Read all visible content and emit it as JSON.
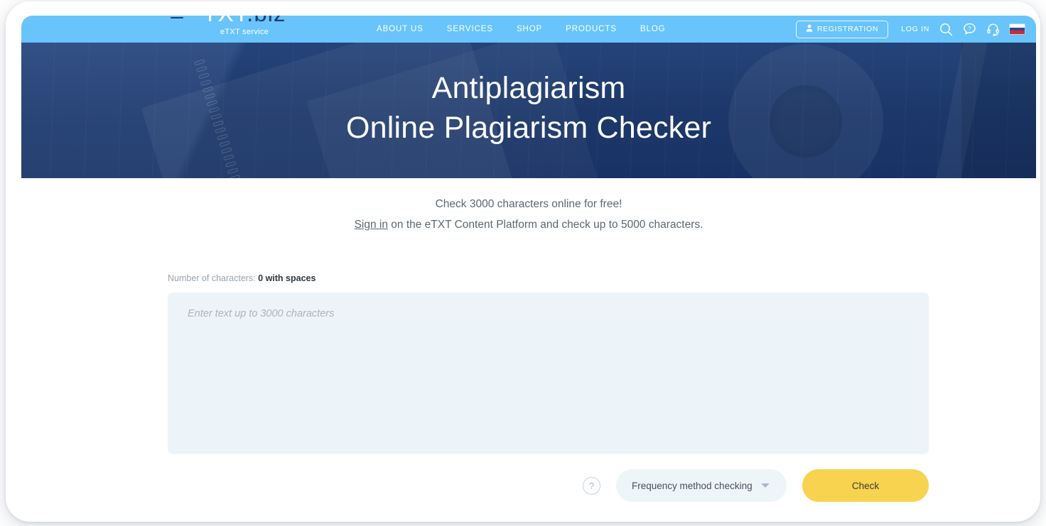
{
  "header": {
    "logo": {
      "mark_main": "TXT",
      "mark_suffix": ".biz",
      "subtitle": "eTXT service",
      "menu_icon": "hamburger-icon"
    },
    "nav": [
      {
        "label": "ABOUT US"
      },
      {
        "label": "SERVICES"
      },
      {
        "label": "SHOP"
      },
      {
        "label": "PRODUCTS"
      },
      {
        "label": "BLOG"
      }
    ],
    "registration_label": "REGISTRATION",
    "login_label": "LOG IN",
    "icons": {
      "search": "search-icon",
      "help": "help-chat-icon",
      "support": "headset-icon",
      "language": "russian-flag-icon"
    },
    "colors": {
      "bar": "#68c4fb"
    }
  },
  "hero": {
    "title": "Antiplagiarism\nOnline Plagiarism Checker",
    "background_color": "#1f3e76"
  },
  "main": {
    "subtitle_line1": "Check 3000 characters online for free!",
    "signin_link": "Sign in",
    "subtitle_line2_rest": " on the eTXT Content Platform and check up to 5000 characters.",
    "counter_label": "Number of characters: ",
    "counter_value": "0 with spaces",
    "textarea": {
      "value": "",
      "placeholder": "Enter text up to 3000 characters"
    },
    "help_icon_label": "?",
    "method_select": {
      "selected": "Frequency method checking"
    },
    "check_button": "Check",
    "colors": {
      "textarea_bg": "#edf4f9",
      "check_button": "#f7d34f",
      "select_bg": "#eef5f9"
    }
  }
}
